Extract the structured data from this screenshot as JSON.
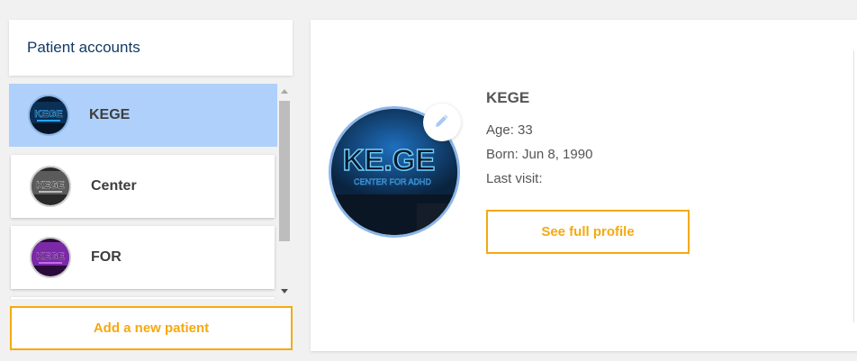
{
  "sidebar": {
    "title": "Patient accounts",
    "patients": [
      {
        "name": "KEGE",
        "selected": true
      },
      {
        "name": "Center",
        "selected": false
      },
      {
        "name": "FOR",
        "selected": false
      }
    ],
    "add_label": "Add a new patient"
  },
  "profile": {
    "name": "KEGE",
    "age": "Age: 33",
    "born": "Born: Jun 8, 1990",
    "last_visit": "Last visit:",
    "full_profile_label": "See full profile",
    "photo_text": "KE.GE",
    "photo_subtext": "CENTER FOR ADHD"
  },
  "icons": {
    "edit": "pencil-icon"
  },
  "colors": {
    "accent": "#f5a90f",
    "selected": "#aed0fb",
    "title": "#123a63"
  }
}
